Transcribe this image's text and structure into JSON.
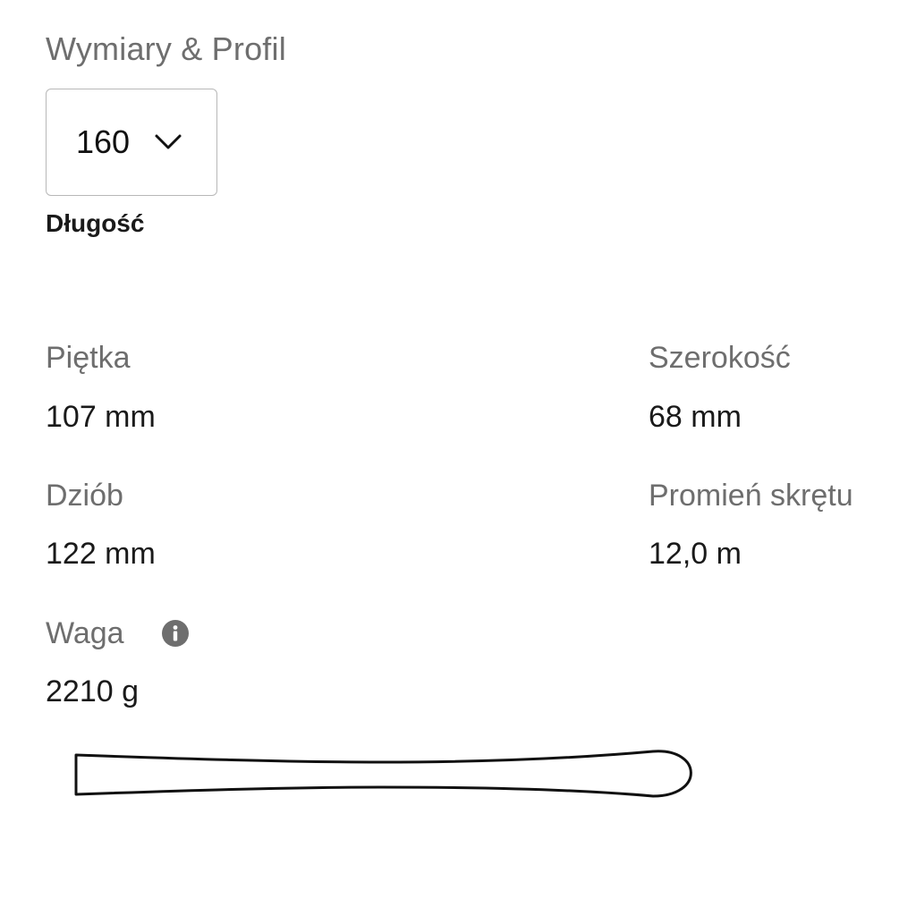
{
  "section": {
    "title": "Wymiary & Profil"
  },
  "length_select": {
    "value": "160",
    "label": "Długość",
    "icon": "chevron-down-icon"
  },
  "specs": {
    "heel": {
      "label": "Piętka",
      "value": "107 mm"
    },
    "width": {
      "label": "Szerokość",
      "value": "68 mm"
    },
    "tip": {
      "label": "Dziób",
      "value": "122 mm"
    },
    "radius": {
      "label": "Promień skrętu",
      "value": "12,0 m"
    },
    "weight": {
      "label": "Waga",
      "value": "2210 g",
      "icon": "info-icon"
    }
  },
  "colors": {
    "label_gray": "#6e6e6e",
    "text_dark": "#1a1a1a",
    "border": "#b8b8b8"
  }
}
